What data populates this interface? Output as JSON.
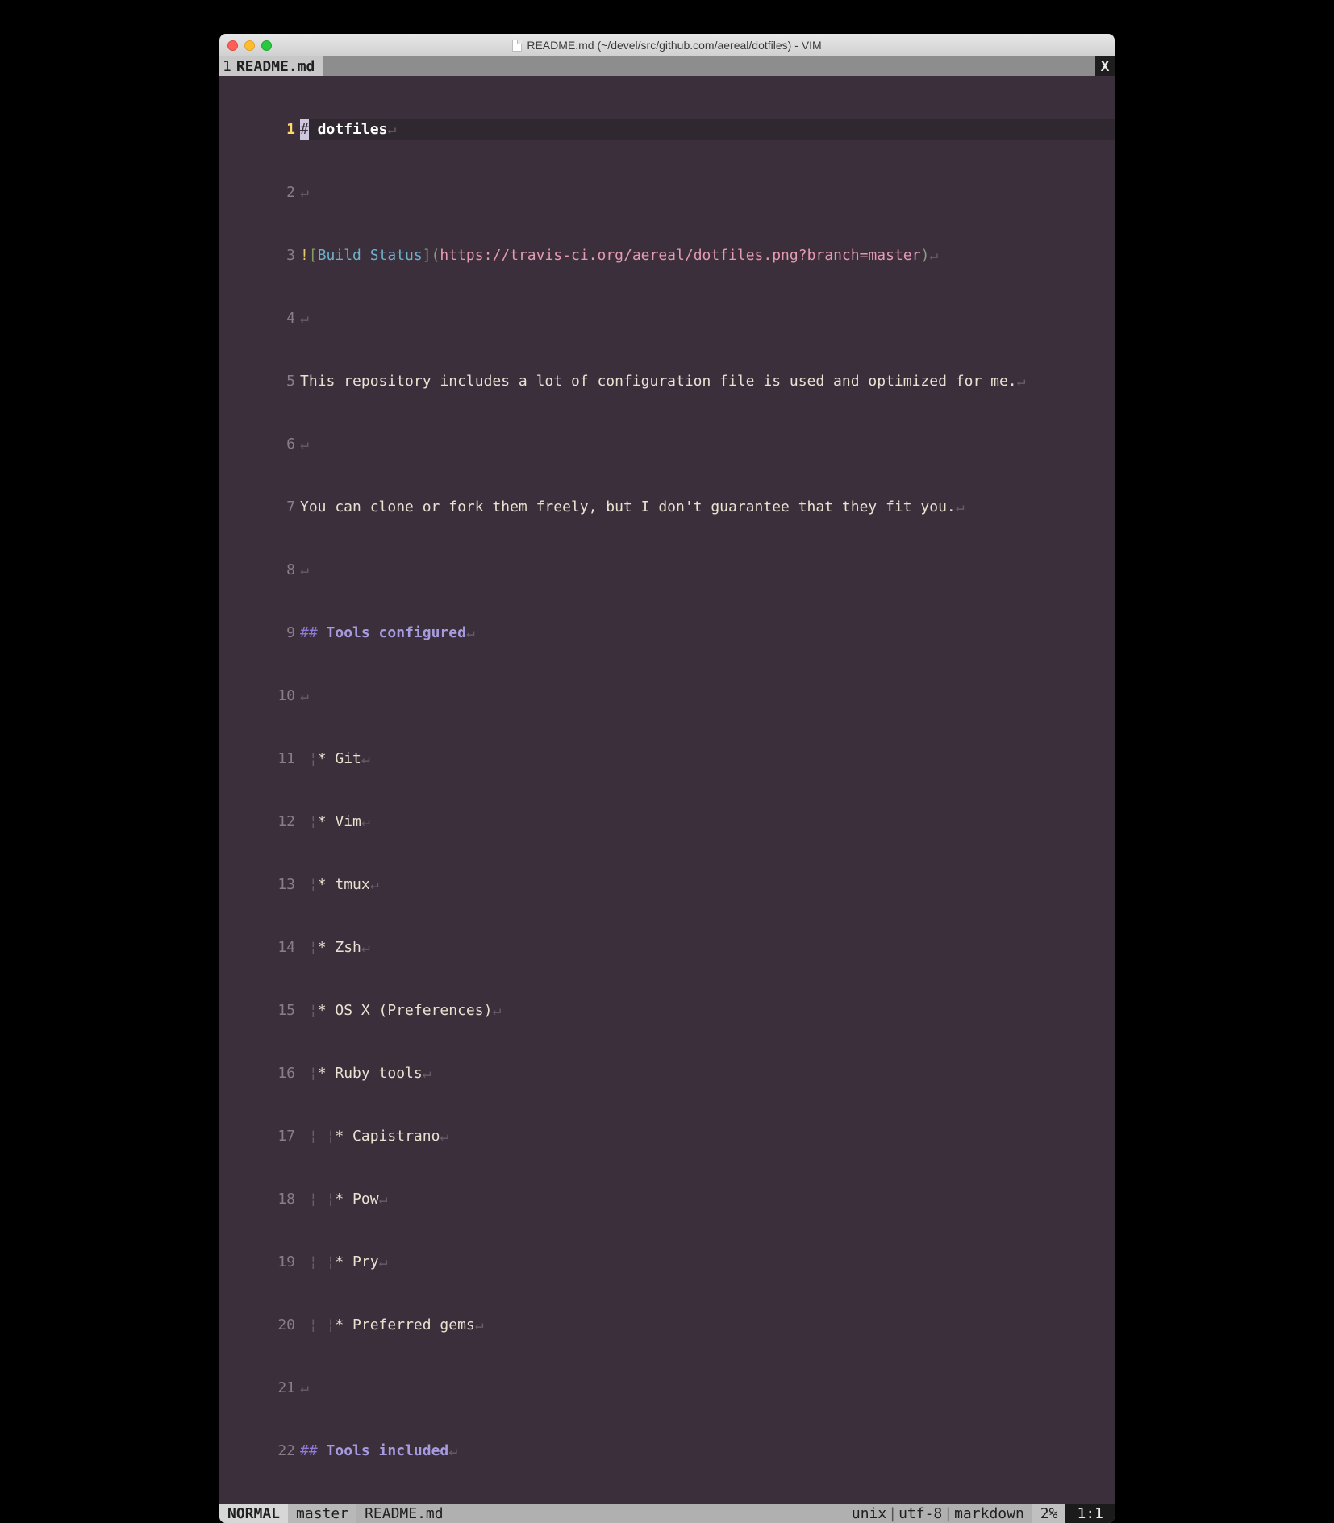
{
  "window": {
    "title": "README.md (~/devel/src/github.com/aereal/dotfiles) - VIM"
  },
  "tabline": {
    "index": "1",
    "filename": "README.md",
    "close": "X"
  },
  "lines": {
    "l1_mark": "#",
    "l1_text": " dotfiles",
    "l3_excl": "!",
    "l3_lb": "[",
    "l3_link": "Build Status",
    "l3_rb": "]",
    "l3_lp": "(",
    "l3_url": "https://travis-ci.org/aereal/dotfiles.png?branch=master",
    "l3_rp": ")",
    "l5": "This repository includes a lot of configuration file is used and optimized for me.",
    "l7": "You can clone or fork them freely, but I don't guarantee that they fit you.",
    "l9_mark": "##",
    "l9_text": " Tools configured",
    "l11": "* Git",
    "l12": "* Vim",
    "l13": "* tmux",
    "l14": "* Zsh",
    "l15": "* OS X (Preferences)",
    "l16": "* Ruby tools",
    "l17": "* Capistrano",
    "l18": "* Pow",
    "l19": "* Pry",
    "l20": "* Preferred gems",
    "l22_mark": "##",
    "l22_text": " Tools included"
  },
  "linenos": {
    "n1": "1",
    "n2": "2",
    "n3": "3",
    "n4": "4",
    "n5": "5",
    "n6": "6",
    "n7": "7",
    "n8": "8",
    "n9": "9",
    "n10": "10",
    "n11": "11",
    "n12": "12",
    "n13": "13",
    "n14": "14",
    "n15": "15",
    "n16": "16",
    "n17": "17",
    "n18": "18",
    "n19": "19",
    "n20": "20",
    "n21": "21",
    "n22": "22"
  },
  "status": {
    "mode": "NORMAL",
    "branch": "master",
    "file": "README.md",
    "format": "unix",
    "encoding": "utf-8",
    "filetype": "markdown",
    "percent": "2%",
    "position": "1:1"
  },
  "glyph": {
    "nl": "↵",
    "sep": "|",
    "indent": "¦"
  }
}
